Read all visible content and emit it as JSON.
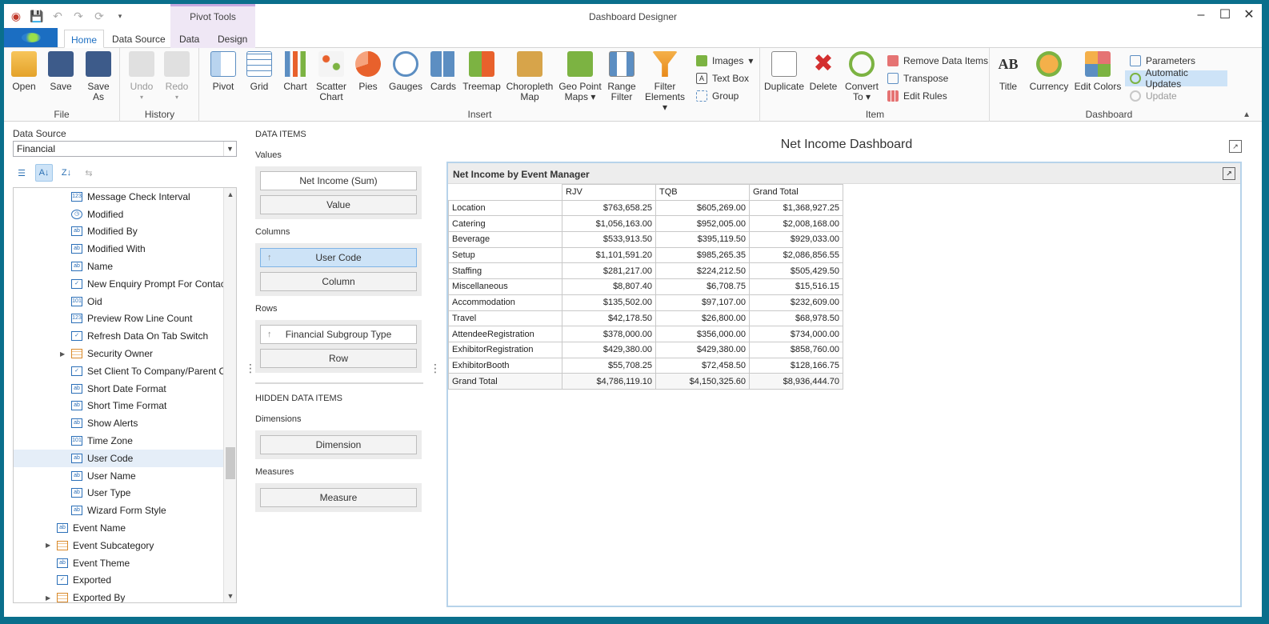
{
  "window": {
    "title": "Dashboard Designer",
    "contextual_tab_group": "Pivot Tools",
    "controls": [
      "minimize",
      "maximize",
      "close"
    ]
  },
  "tabs": [
    "Home",
    "Data Source",
    "Data",
    "Design"
  ],
  "ribbon": {
    "file": {
      "label": "File",
      "open": "Open",
      "save": "Save",
      "save_as": "Save As"
    },
    "history": {
      "label": "History",
      "undo": "Undo",
      "redo": "Redo"
    },
    "insert": {
      "label": "Insert",
      "pivot": "Pivot",
      "grid": "Grid",
      "chart": "Chart",
      "scatter_1": "Scatter",
      "scatter_2": "Chart",
      "pies": "Pies",
      "gauges": "Gauges",
      "cards": "Cards",
      "treemap": "Treemap",
      "choropleth_1": "Choropleth",
      "choropleth_2": "Map",
      "geo_1": "Geo Point",
      "geo_2": "Maps",
      "range_1": "Range",
      "range_2": "Filter",
      "filter_1": "Filter",
      "filter_2": "Elements",
      "images": "Images",
      "text_box": "Text Box",
      "group": "Group"
    },
    "item": {
      "label": "Item",
      "duplicate": "Duplicate",
      "delete": "Delete",
      "convert_1": "Convert",
      "convert_2": "To",
      "remove_data_items": "Remove Data Items",
      "transpose": "Transpose",
      "edit_rules": "Edit Rules"
    },
    "dashboard": {
      "label": "Dashboard",
      "title": "Title",
      "currency": "Currency",
      "edit_colors": "Edit Colors",
      "parameters": "Parameters",
      "automatic_updates": "Automatic Updates",
      "update": "Update"
    }
  },
  "data_source": {
    "label": "Data Source",
    "selected": "Financial",
    "fields": [
      {
        "name": "Message Check Interval",
        "icon": "123"
      },
      {
        "name": "Modified",
        "icon": "clock"
      },
      {
        "name": "Modified By",
        "icon": "ab"
      },
      {
        "name": "Modified With",
        "icon": "ab"
      },
      {
        "name": "Name",
        "icon": "ab"
      },
      {
        "name": "New Enquiry Prompt For Contac...",
        "icon": "check"
      },
      {
        "name": "Oid",
        "icon": "101"
      },
      {
        "name": "Preview Row Line Count",
        "icon": "123"
      },
      {
        "name": "Refresh Data On Tab Switch",
        "icon": "check"
      },
      {
        "name": "Security Owner",
        "icon": "table"
      },
      {
        "name": "Set Client To Company/Parent C...",
        "icon": "check"
      },
      {
        "name": "Short Date Format",
        "icon": "ab"
      },
      {
        "name": "Short Time Format",
        "icon": "ab"
      },
      {
        "name": "Show Alerts",
        "icon": "ab"
      },
      {
        "name": "Time Zone",
        "icon": "101"
      },
      {
        "name": "User Code",
        "icon": "ab"
      },
      {
        "name": "User Name",
        "icon": "ab"
      },
      {
        "name": "User Type",
        "icon": "ab"
      },
      {
        "name": "Wizard Form Style",
        "icon": "ab"
      },
      {
        "name": "Event Name",
        "icon": "ab"
      },
      {
        "name": "Event Subcategory",
        "icon": "table"
      },
      {
        "name": "Event Theme",
        "icon": "ab"
      },
      {
        "name": "Exported",
        "icon": "check"
      },
      {
        "name": "Exported By",
        "icon": "table"
      }
    ]
  },
  "data_items": {
    "title": "DATA ITEMS",
    "values_label": "Values",
    "values": [
      "Net Income (Sum)",
      "Value"
    ],
    "columns_label": "Columns",
    "columns": [
      "User Code",
      "Column"
    ],
    "rows_label": "Rows",
    "rows": [
      "Financial Subgroup Type",
      "Row"
    ],
    "hidden_title": "HIDDEN DATA ITEMS",
    "dimensions_label": "Dimensions",
    "dimension_placeholder": "Dimension",
    "measures_label": "Measures",
    "measure_placeholder": "Measure"
  },
  "dashboard": {
    "title": "Net Income Dashboard",
    "pivot": {
      "title": "Net Income by Event Manager",
      "columns": [
        "RJV",
        "TQB",
        "Grand Total"
      ],
      "rows": [
        {
          "label": "Location",
          "values": [
            "$763,658.25",
            "$605,269.00",
            "$1,368,927.25"
          ]
        },
        {
          "label": "Catering",
          "values": [
            "$1,056,163.00",
            "$952,005.00",
            "$2,008,168.00"
          ]
        },
        {
          "label": "Beverage",
          "values": [
            "$533,913.50",
            "$395,119.50",
            "$929,033.00"
          ]
        },
        {
          "label": "Setup",
          "values": [
            "$1,101,591.20",
            "$985,265.35",
            "$2,086,856.55"
          ]
        },
        {
          "label": "Staffing",
          "values": [
            "$281,217.00",
            "$224,212.50",
            "$505,429.50"
          ]
        },
        {
          "label": "Miscellaneous",
          "values": [
            "$8,807.40",
            "$6,708.75",
            "$15,516.15"
          ]
        },
        {
          "label": "Accommodation",
          "values": [
            "$135,502.00",
            "$97,107.00",
            "$232,609.00"
          ]
        },
        {
          "label": "Travel",
          "values": [
            "$42,178.50",
            "$26,800.00",
            "$68,978.50"
          ]
        },
        {
          "label": "AttendeeRegistration",
          "values": [
            "$378,000.00",
            "$356,000.00",
            "$734,000.00"
          ]
        },
        {
          "label": "ExhibitorRegistration",
          "values": [
            "$429,380.00",
            "$429,380.00",
            "$858,760.00"
          ]
        },
        {
          "label": "ExhibitorBooth",
          "values": [
            "$55,708.25",
            "$72,458.50",
            "$128,166.75"
          ]
        },
        {
          "label": "Grand Total",
          "values": [
            "$4,786,119.10",
            "$4,150,325.60",
            "$8,936,444.70"
          ]
        }
      ]
    }
  }
}
